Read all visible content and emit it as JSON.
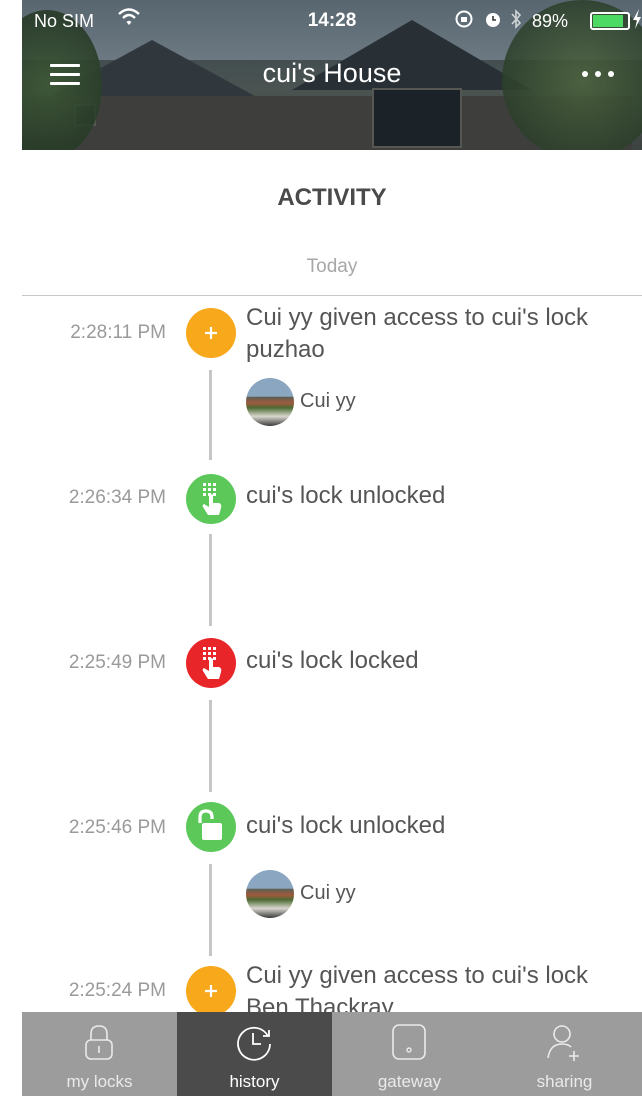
{
  "status_bar": {
    "carrier": "No SIM",
    "time": "14:28",
    "battery_percent": "89%",
    "battery_level": 0.89
  },
  "header": {
    "title": "cui's House",
    "menu_icon": "hamburger-menu-icon",
    "more_icon": "more-dots-icon"
  },
  "activity": {
    "title": "ACTIVITY",
    "day": "Today",
    "events": [
      {
        "time": "2:28:11 PM",
        "icon": "plus-icon",
        "color": "#f7a81b",
        "text": "Cui yy given access to cui's lock  puzhao",
        "user": "Cui yy"
      },
      {
        "time": "2:26:34 PM",
        "icon": "keypad-hand-icon",
        "color": "#5cc85a",
        "text": "cui's lock  unlocked"
      },
      {
        "time": "2:25:49 PM",
        "icon": "keypad-hand-icon",
        "color": "#e8262a",
        "text": "cui's lock  locked"
      },
      {
        "time": "2:25:46 PM",
        "icon": "unlocked-padlock-icon",
        "color": "#5cc85a",
        "text": "cui's lock  unlocked",
        "user": "Cui yy"
      },
      {
        "time": "2:25:24 PM",
        "icon": "plus-icon",
        "color": "#f7a81b",
        "text": "Cui yy given access to cui's lock  Ben Thackray"
      }
    ]
  },
  "tabs": [
    {
      "label": "my locks",
      "icon": "lock-icon",
      "active": false
    },
    {
      "label": "history",
      "icon": "history-clock-icon",
      "active": true
    },
    {
      "label": "gateway",
      "icon": "gateway-device-icon",
      "active": false
    },
    {
      "label": "sharing",
      "icon": "add-user-icon",
      "active": false
    }
  ]
}
